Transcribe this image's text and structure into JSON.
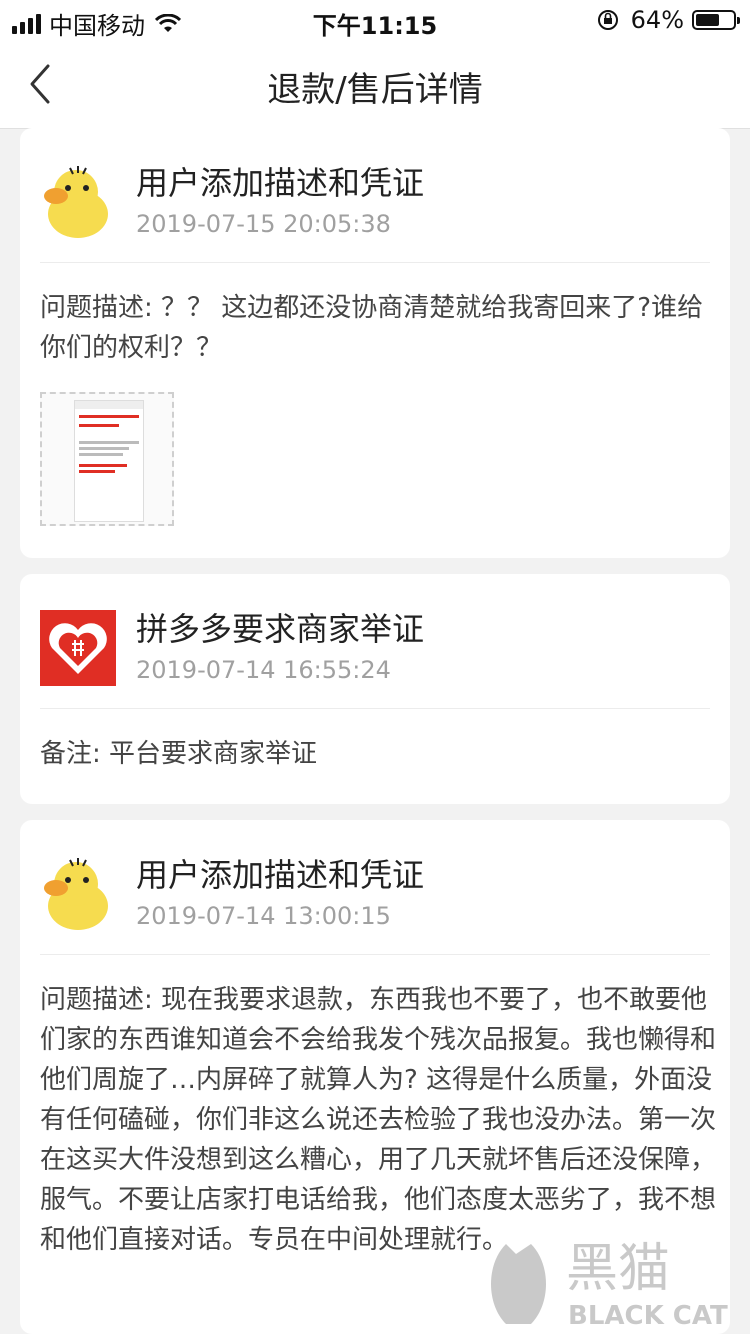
{
  "status_bar": {
    "carrier": "中国移动",
    "time": "下午11:15",
    "battery": "64%",
    "battery_level": 0.64
  },
  "nav": {
    "title": "退款/售后详情"
  },
  "cards": [
    {
      "title": "用户添加描述和凭证",
      "time": "2019-07-15 20:05:38",
      "body": "问题描述: ？？ 这边都还没协商清楚就给我寄回来了?谁给你们的权利？？"
    },
    {
      "title": "拼多多要求商家举证",
      "time": "2019-07-14 16:55:24",
      "body": "备注: 平台要求商家举证"
    },
    {
      "title": "用户添加描述和凭证",
      "time": "2019-07-14 13:00:15",
      "body": "问题描述: 现在我要求退款，东西我也不要了，也不敢要他们家的东西谁知道会不会给我发个残次品报复。我也懒得和他们周旋了…内屏碎了就算人为? 这得是什么质量，外面没有任何磕碰，你们非这么说还去检验了我也没办法。第一次在这买大件没想到这么糟心，用了几天就坏售后还没保障，服气。不要让店家打电话给我，他们态度太恶劣了，我不想和他们直接对话。专员在中间处理就行。"
    }
  ],
  "watermark": {
    "text": "黑猫",
    "sub": "BLACK CAT"
  },
  "colors": {
    "accent_red": "#e02e24",
    "duck_yellow": "#f6dc4f"
  }
}
